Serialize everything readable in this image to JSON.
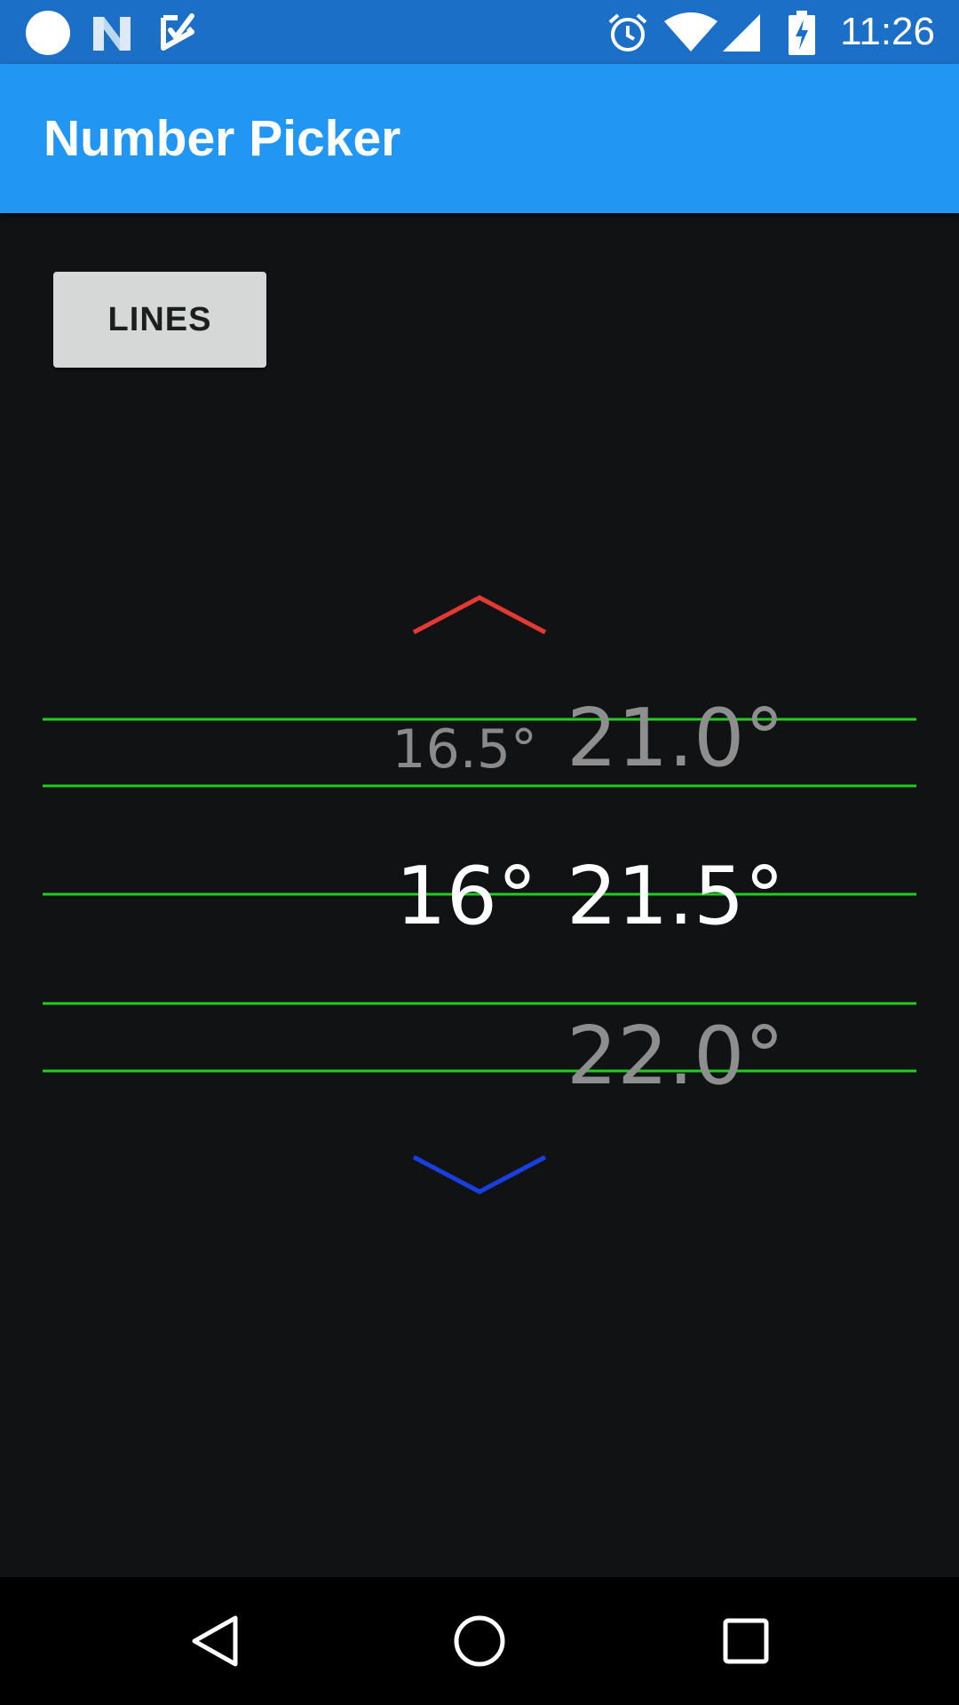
{
  "status_bar": {
    "time": "11:26",
    "left_icons": [
      "circle-notification-icon",
      "n-notification-icon",
      "checkmark-notification-icon"
    ],
    "right_icons": [
      "alarm-icon",
      "wifi-icon",
      "cellular-signal-icon",
      "battery-charging-icon"
    ]
  },
  "app_bar": {
    "title": "Number Picker",
    "color": "#2196f3"
  },
  "lines_button": {
    "label": "LINES"
  },
  "picker": {
    "increment_arrow_color": "#e53935",
    "decrement_arrow_color": "#1a3fe0",
    "divider_color": "#22cc22",
    "left_column": {
      "above": "16.5°",
      "selected": "16°"
    },
    "right_column": {
      "above": "21.0°",
      "selected": "21.5°",
      "below": "22.0°"
    }
  },
  "nav_bar": {
    "buttons": [
      "back-icon",
      "home-icon",
      "recents-icon"
    ]
  }
}
